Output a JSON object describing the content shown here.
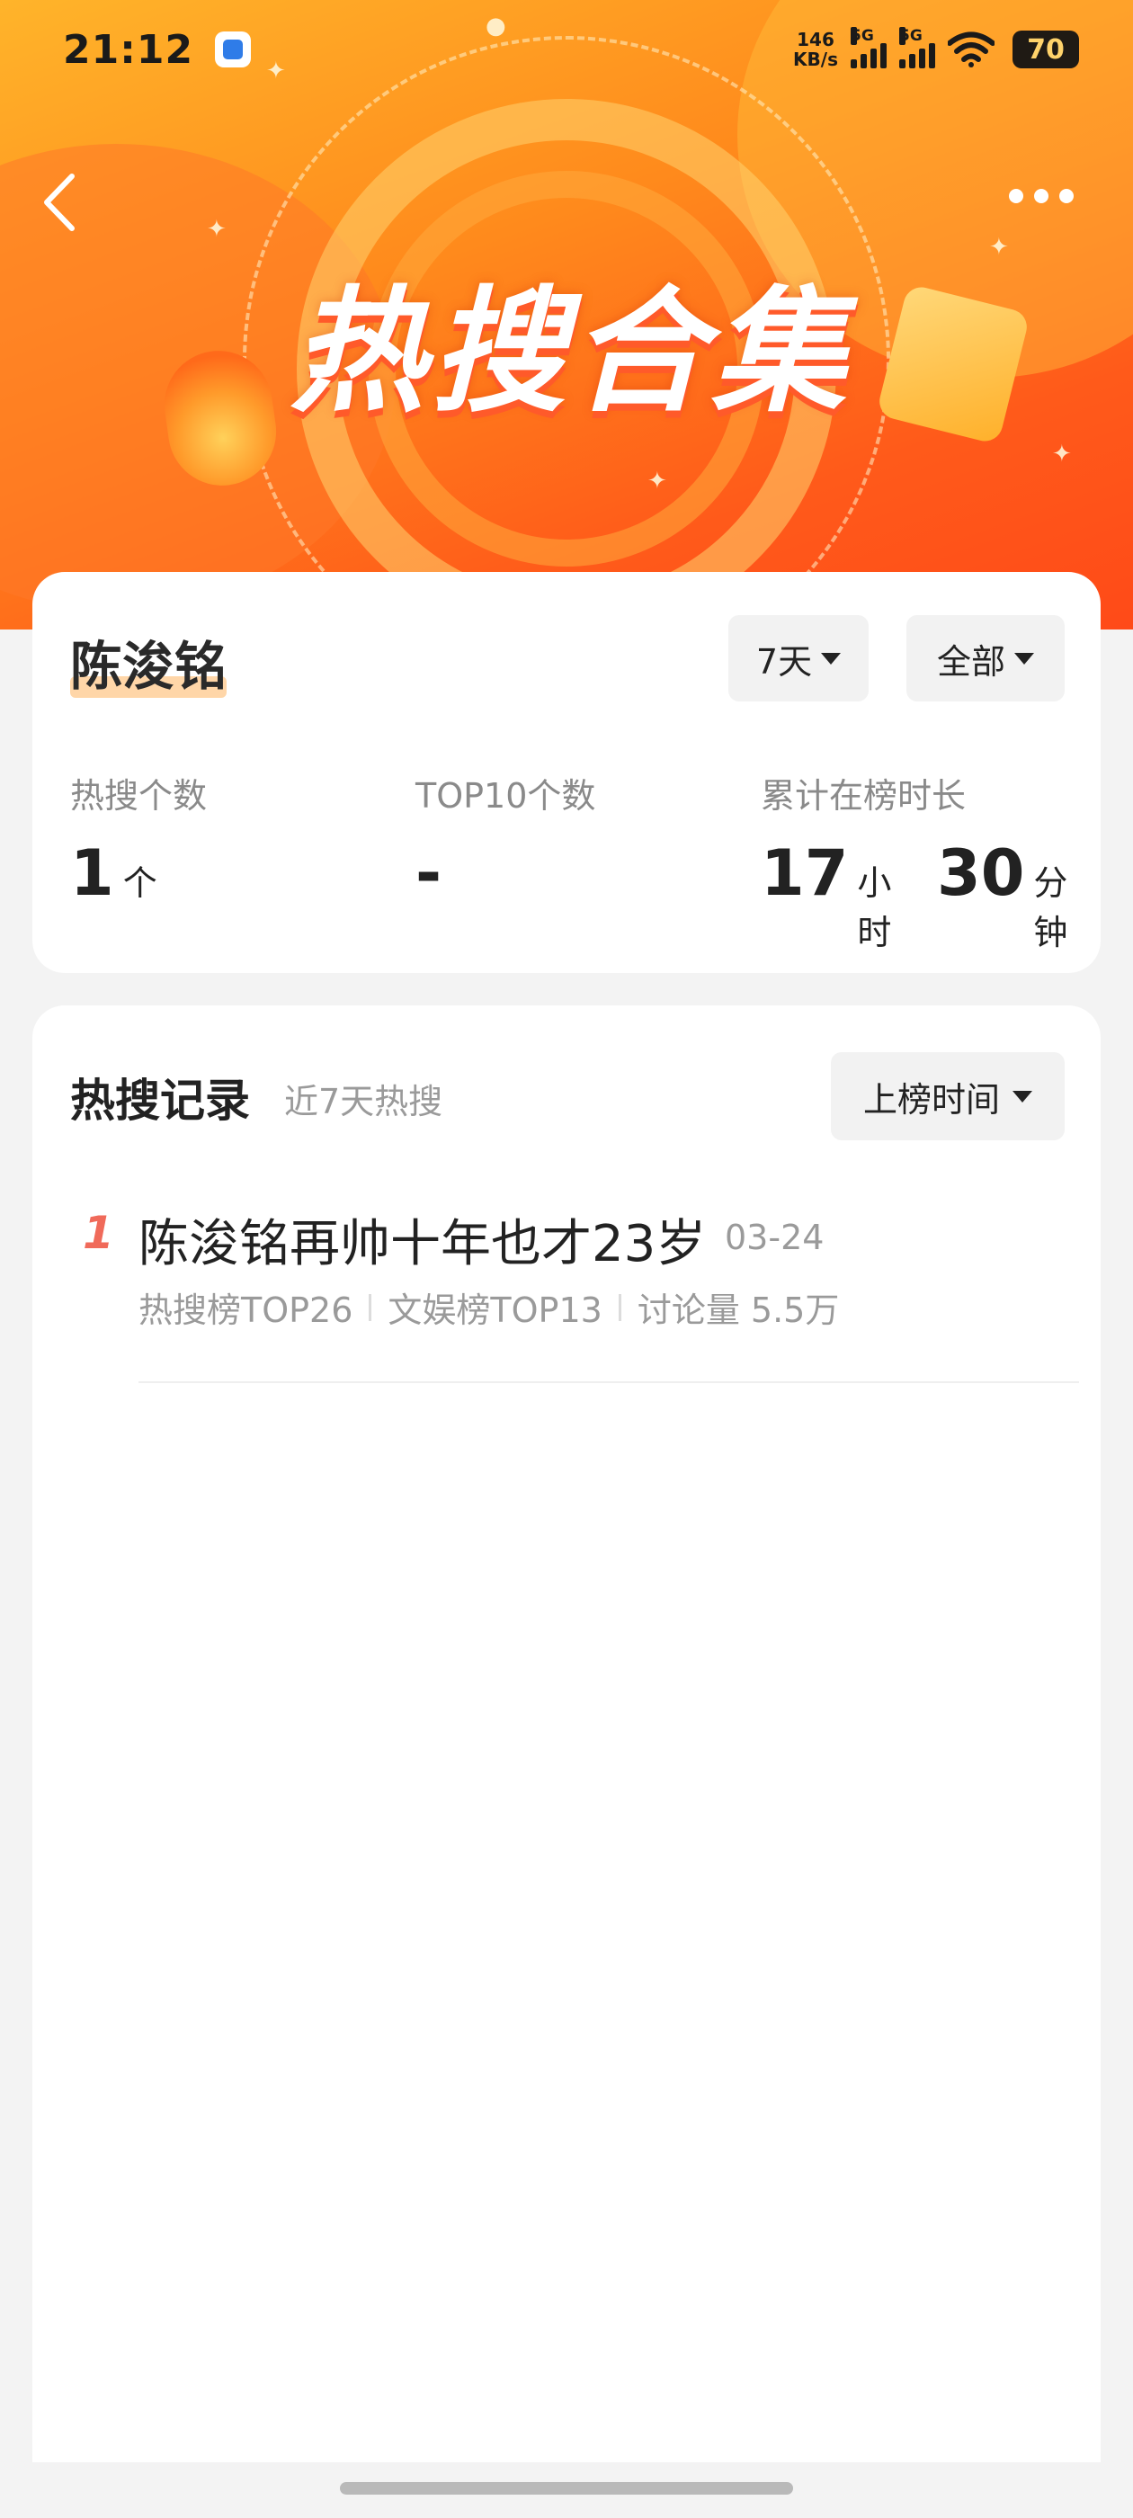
{
  "status_bar": {
    "time": "21:12",
    "net_speed_value": "146",
    "net_speed_unit": "KB/s",
    "sim1_label": "5G",
    "sim2_label": "5G",
    "battery": "70"
  },
  "banner": {
    "title": "热搜合集"
  },
  "summary": {
    "name": "陈浚铭",
    "period_filter": "7天",
    "category_filter": "全部",
    "stats": [
      {
        "label": "热搜个数",
        "value": "1",
        "unit": "个"
      },
      {
        "label": "TOP10个数",
        "value": "-"
      },
      {
        "label": "累计在榜时长",
        "value_hours": "17",
        "unit_hours": "小时",
        "value_minutes": "30",
        "unit_minutes": "分钟"
      }
    ]
  },
  "records": {
    "title": "热搜记录",
    "subtitle": "近7天热搜",
    "sort_label": "上榜时间",
    "items": [
      {
        "rank": "1",
        "title": "陈浚铭再帅十年也才23岁",
        "date": "03-24",
        "meta": [
          "热搜榜TOP26",
          "文娱榜TOP13",
          "讨论量 5.5万"
        ]
      }
    ]
  }
}
